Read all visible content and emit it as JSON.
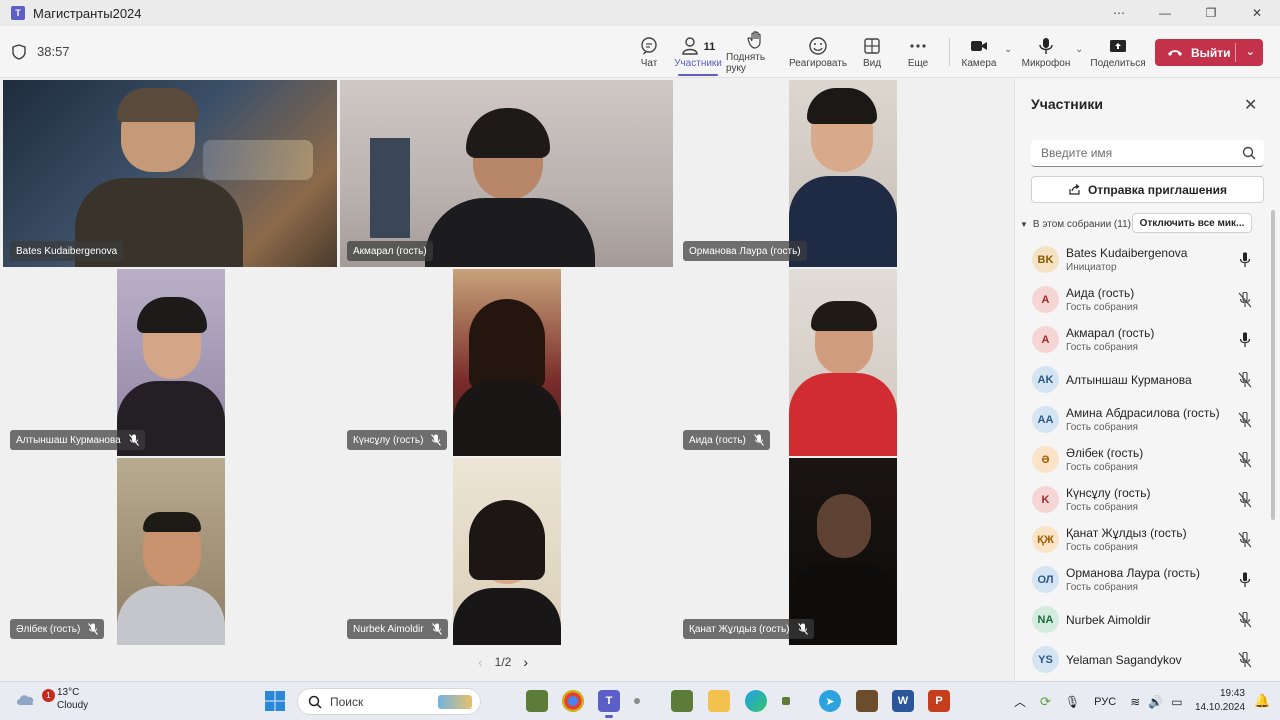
{
  "window": {
    "title": "Магистранты2024"
  },
  "toolbar": {
    "timer": "38:57",
    "chat": "Чат",
    "participants": "Участники",
    "participants_count": "11",
    "raise_hand": "Поднять руку",
    "react": "Реагировать",
    "view": "Вид",
    "more": "Еще",
    "camera": "Камера",
    "mic": "Микрофон",
    "share": "Поделиться",
    "leave": "Выйти"
  },
  "grid": {
    "tiles": [
      {
        "name": "Bates Kudaibergenova",
        "muted": false
      },
      {
        "name": "Акмарал (гость)",
        "muted": false
      },
      {
        "name": "Орманова Лаура (гость)",
        "muted": false
      },
      {
        "name": "Алтыншаш Курманова",
        "muted": true
      },
      {
        "name": "Күнсұлу (гость)",
        "muted": true
      },
      {
        "name": "Аида (гость)",
        "muted": true
      },
      {
        "name": "Әлібек (гость)",
        "muted": true
      },
      {
        "name": "Nurbek Aimoldir",
        "muted": true
      },
      {
        "name": "Қанат Жұлдыз (гость)",
        "muted": true
      }
    ],
    "page": "1/2"
  },
  "panel": {
    "title": "Участники",
    "search_placeholder": "Введите имя",
    "invite_label": "Отправка приглашения",
    "section_label": "В этом собрании (11)",
    "mute_all": "Отключить все мик...",
    "participants": [
      {
        "initials": "BK",
        "name": "Bates Kudaibergenova",
        "role": "Инициатор",
        "mic_on": true,
        "color": "#f4e3c3",
        "text": "#8a5a00"
      },
      {
        "initials": "A",
        "name": "Аида (гость)",
        "role": "Гость собрания",
        "mic_on": false,
        "color": "#f6d6d4",
        "text": "#a4262c"
      },
      {
        "initials": "A",
        "name": "Акмарал (гость)",
        "role": "Гость собрания",
        "mic_on": true,
        "color": "#f6d6d4",
        "text": "#a4262c"
      },
      {
        "initials": "AK",
        "name": "Алтыншаш Курманова",
        "role": "",
        "mic_on": false,
        "color": "#d5e4f2",
        "text": "#2b5a88"
      },
      {
        "initials": "AA",
        "name": "Амина Абдрасилова (гость)",
        "role": "Гость собрания",
        "mic_on": false,
        "color": "#d5e4f2",
        "text": "#2b5a88"
      },
      {
        "initials": "Ә",
        "name": "Әлібек (гость)",
        "role": "Гость собрания",
        "mic_on": false,
        "color": "#fbe3c8",
        "text": "#a35c00"
      },
      {
        "initials": "K",
        "name": "Күнсұлу (гость)",
        "role": "Гость собрания",
        "mic_on": false,
        "color": "#f6d6d4",
        "text": "#a4262c"
      },
      {
        "initials": "ҚЖ",
        "name": "Қанат Жұлдыз (гость)",
        "role": "Гость собрания",
        "mic_on": false,
        "color": "#fbe3c8",
        "text": "#a35c00"
      },
      {
        "initials": "ОЛ",
        "name": "Орманова Лаура (гость)",
        "role": "Гость собрания",
        "mic_on": true,
        "color": "#d5e4f2",
        "text": "#2b5a88"
      },
      {
        "initials": "NA",
        "name": "Nurbek Aimoldir",
        "role": "",
        "mic_on": false,
        "color": "#d3ecdf",
        "text": "#1c6b3e"
      },
      {
        "initials": "YS",
        "name": "Yelaman Sagandykov",
        "role": "",
        "mic_on": false,
        "color": "#d5e4f2",
        "text": "#2b5a88"
      }
    ]
  },
  "taskbar": {
    "weather_temp": "13°C",
    "weather_desc": "Cloudy",
    "weather_badge": "1",
    "search_label": "Поиск",
    "lang": "РУС",
    "time": "19:43",
    "date": "14.10.2024"
  }
}
